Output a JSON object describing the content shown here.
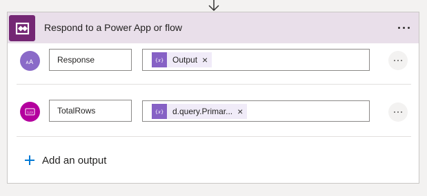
{
  "action": {
    "title": "Respond to a Power App or flow",
    "header_color": "#e9dfea",
    "brand_color": "#742774",
    "icon": "power-apps-icon",
    "more_icon": "more-options-icon"
  },
  "outputs": [
    {
      "type": "text",
      "type_icon": "text-type-icon",
      "type_icon_text": "AA",
      "type_color": "#8a6ac8",
      "name": "Response",
      "token": {
        "label": "Output",
        "icon": "expression-icon",
        "remove_icon": "×"
      }
    },
    {
      "type": "number",
      "type_icon": "number-type-icon",
      "type_icon_text": "123",
      "type_color": "#b4009e",
      "name": "TotalRows",
      "token": {
        "label": "d.query.Primar...",
        "icon": "expression-icon",
        "remove_icon": "×"
      }
    }
  ],
  "add_output": {
    "label": "Add an output",
    "icon": "plus-icon",
    "color": "#0078d4"
  }
}
